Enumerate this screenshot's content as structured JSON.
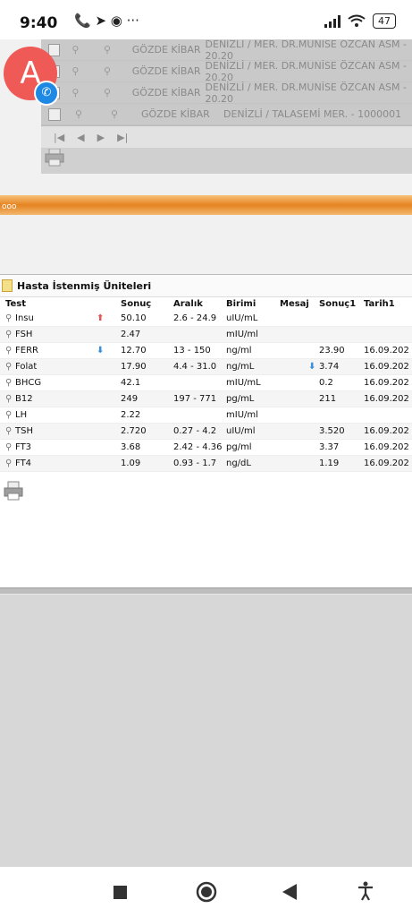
{
  "status_bar": {
    "time": "9:40",
    "icons": "📞 ➤ ◉ ···",
    "battery": "47"
  },
  "background_grid": {
    "rows": [
      {
        "name": "GÖZDE KİBAR",
        "location": "DENİZLİ / MER. DR.MUNİSE ÖZCAN ASM - 20.20"
      },
      {
        "name": "GÖZDE KİBAR",
        "location": "DENİZLİ / MER. DR.MUNİSE ÖZCAN ASM - 20.20"
      },
      {
        "name": "GÖZDE KİBAR",
        "location": "DENİZLİ / MER. DR.MUNİSE ÖZCAN ASM - 20.20"
      },
      {
        "name": "GÖZDE KİBAR",
        "location": "DENİZLİ / TALASEMİ MER. - 1000001"
      }
    ],
    "pager": [
      "|◀",
      "◀",
      "▶",
      "▶|"
    ]
  },
  "avatar": {
    "letter": "A"
  },
  "orange_strip": {
    "text": "ooo"
  },
  "panel": {
    "title": "Hasta İstenmiş Üniteleri",
    "headers": [
      "Test",
      "Sonuç",
      "Aralık",
      "Birimi",
      "Mesaj",
      "Sonuç1",
      "Tarih1"
    ],
    "rows": [
      {
        "test": "Insu",
        "flag": "up",
        "sonuc": "50.10",
        "aralik": "2.6 - 24.9",
        "birimi": "uIU/mL",
        "mesaj": "",
        "flag2": "",
        "sonuc1": "",
        "tarih1": ""
      },
      {
        "test": "FSH",
        "flag": "",
        "sonuc": "2.47",
        "aralik": "",
        "birimi": "mIU/ml",
        "mesaj": "",
        "flag2": "",
        "sonuc1": "",
        "tarih1": ""
      },
      {
        "test": "FERR",
        "flag": "down",
        "sonuc": "12.70",
        "aralik": "13 - 150",
        "birimi": "ng/ml",
        "mesaj": "",
        "flag2": "",
        "sonuc1": "23.90",
        "tarih1": "16.09.202"
      },
      {
        "test": "Folat",
        "flag": "",
        "sonuc": "17.90",
        "aralik": "4.4 - 31.0",
        "birimi": "ng/mL",
        "mesaj": "",
        "flag2": "down",
        "sonuc1": "3.74",
        "tarih1": "16.09.202"
      },
      {
        "test": "BHCG",
        "flag": "",
        "sonuc": "42.1",
        "aralik": "",
        "birimi": "mIU/mL",
        "mesaj": "",
        "flag2": "",
        "sonuc1": "0.2",
        "tarih1": "16.09.202"
      },
      {
        "test": "B12",
        "flag": "",
        "sonuc": "249",
        "aralik": "197 - 771",
        "birimi": "pg/mL",
        "mesaj": "",
        "flag2": "",
        "sonuc1": "211",
        "tarih1": "16.09.202"
      },
      {
        "test": "LH",
        "flag": "",
        "sonuc": "2.22",
        "aralik": "",
        "birimi": "mIU/ml",
        "mesaj": "",
        "flag2": "",
        "sonuc1": "",
        "tarih1": ""
      },
      {
        "test": "TSH",
        "flag": "",
        "sonuc": "2.720",
        "aralik": "0.27 - 4.2",
        "birimi": "uIU/ml",
        "mesaj": "",
        "flag2": "",
        "sonuc1": "3.520",
        "tarih1": "16.09.202"
      },
      {
        "test": "FT3",
        "flag": "",
        "sonuc": "3.68",
        "aralik": "2.42 - 4.36",
        "birimi": "pg/ml",
        "mesaj": "",
        "flag2": "",
        "sonuc1": "3.37",
        "tarih1": "16.09.202"
      },
      {
        "test": "FT4",
        "flag": "",
        "sonuc": "1.09",
        "aralik": "0.93 - 1.7",
        "birimi": "ng/dL",
        "mesaj": "",
        "flag2": "",
        "sonuc1": "1.19",
        "tarih1": "16.09.202"
      }
    ]
  },
  "colors": {
    "flag_up": "#e25656",
    "flag_down": "#3a8fd8",
    "avatar": "#ef5a57",
    "orange": "#e58320"
  }
}
